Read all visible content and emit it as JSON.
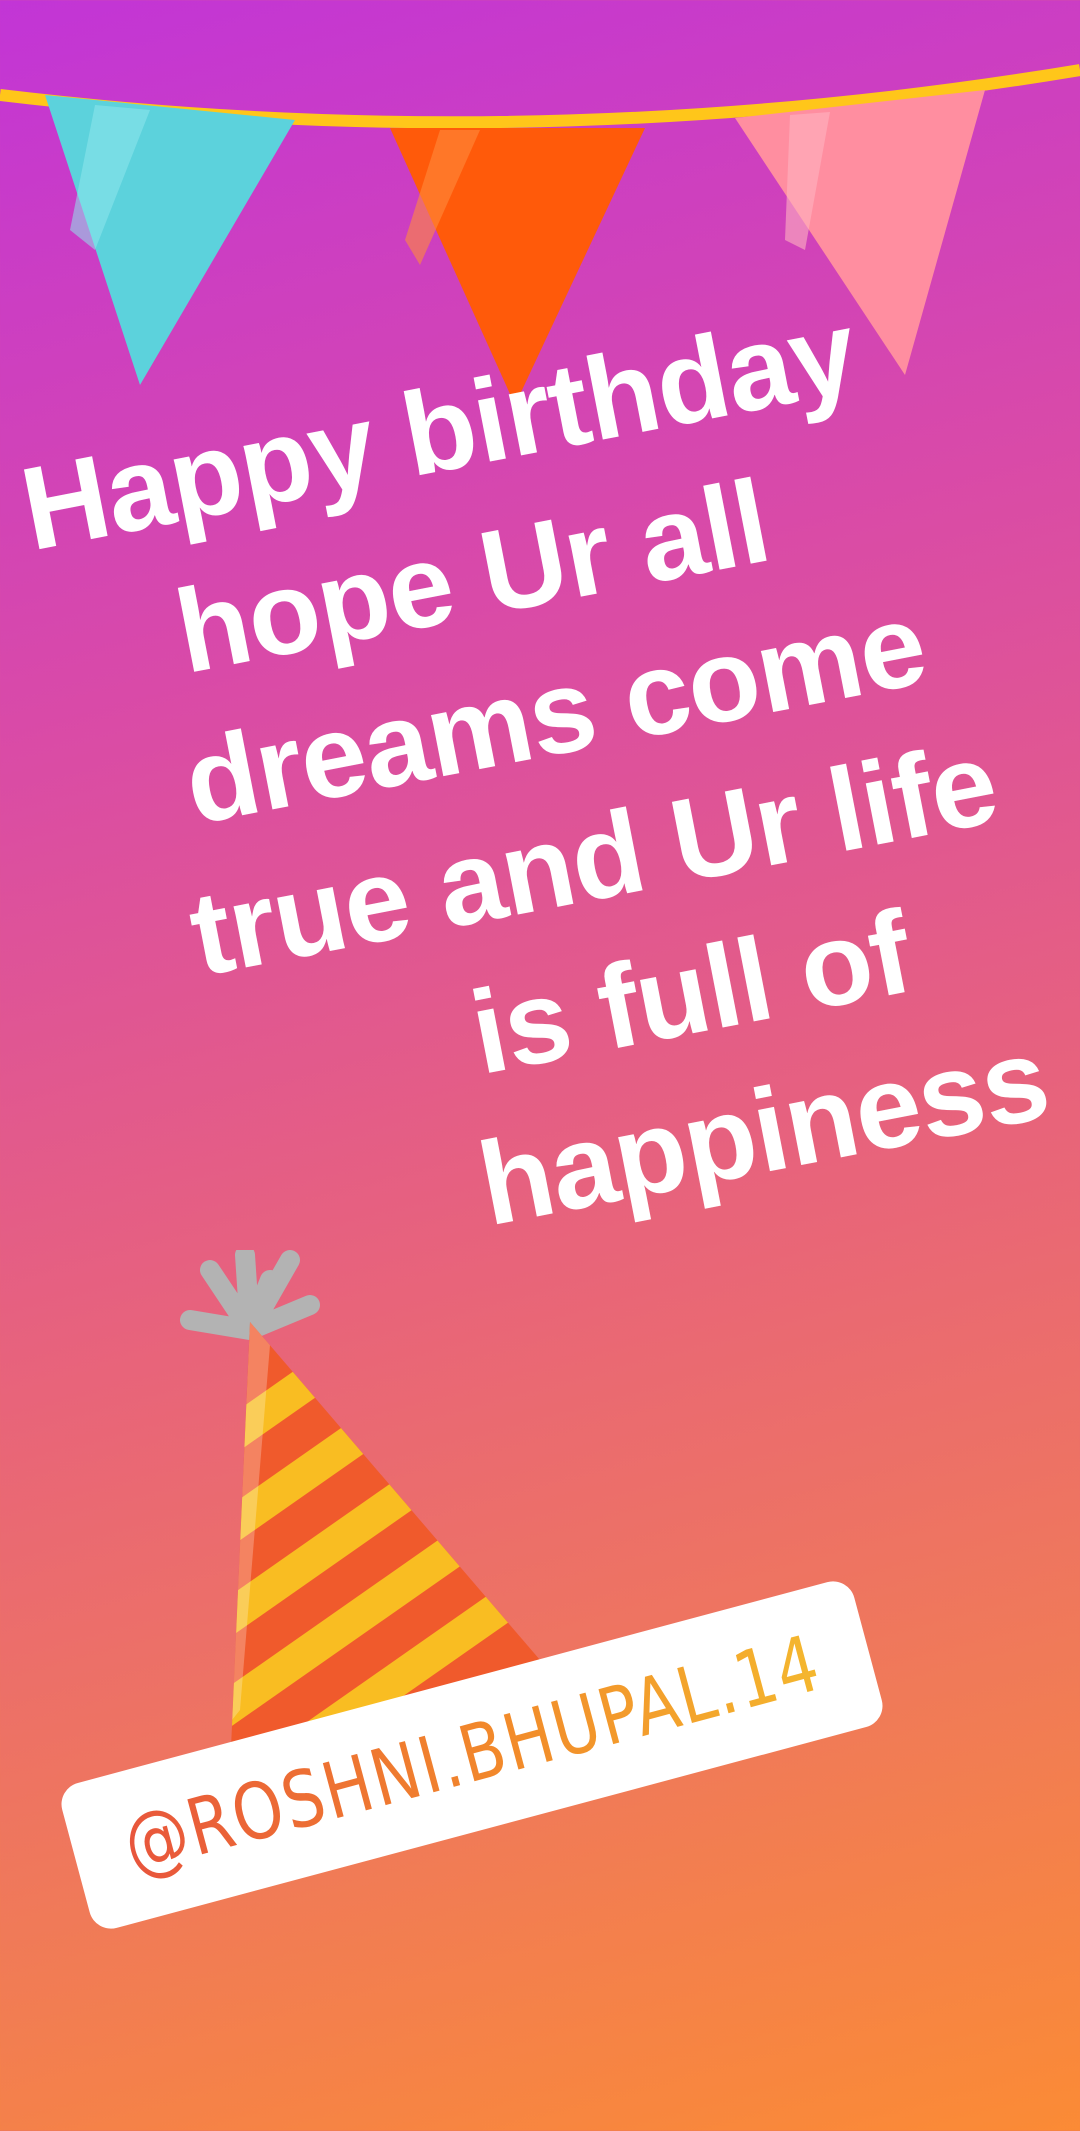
{
  "story": {
    "message_lines": [
      "Happy birthday",
      "hope Ur all",
      "dreams come",
      "true and Ur life",
      "is full of",
      "happiness"
    ],
    "mention": "@ROSHNI.BHUPAL.14"
  },
  "stickers": {
    "bunting": {
      "name": "bunting-flags",
      "colors": [
        "#5cd2dc",
        "#ff5a0a",
        "#ff8ea0"
      ],
      "string_color": "#ffc61a"
    },
    "hat": {
      "name": "party-hat",
      "colors": [
        "#f05a2c",
        "#f9bd22",
        "#b3b3b3"
      ]
    }
  },
  "theme": {
    "gradient": [
      "#c235d6",
      "#d94aa8",
      "#e8647a",
      "#f07a58",
      "#fb8b35"
    ],
    "text_color": "#ffffff"
  }
}
